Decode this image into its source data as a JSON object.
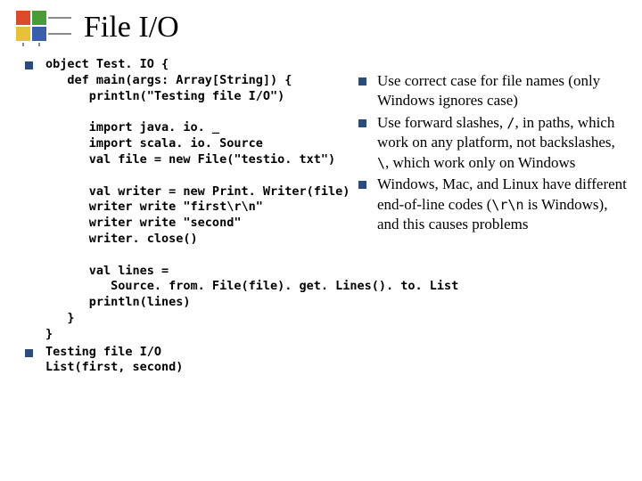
{
  "title": "File I/O",
  "code1": "object Test. IO {\n   def main(args: Array[String]) {\n      println(\"Testing file I/O\")\n\n      import java. io. _\n      import scala. io. Source\n      val file = new File(\"testio. txt\")\n\n      val writer = new Print. Writer(file)\n      writer write \"first\\r\\n\"\n      writer write \"second\"\n      writer. close()\n\n      val lines =\n         Source. from. File(file). get. Lines(). to. List\n      println(lines)\n   }\n}",
  "code2": "Testing file I/O\nList(first, second)",
  "notes": {
    "n1a": "Use correct case for file names (only Windows ignores case)",
    "n2a": "Use forward slashes, ",
    "n2b": "/",
    "n2c": ", in paths, which work on any platform, not backslashes, ",
    "n2d": "\\",
    "n2e": ", which work only on Windows",
    "n3a": "Windows, Mac, and Linux have different end-of-line codes (",
    "n3b": "\\r\\n",
    "n3c": " is Windows), and this causes problems"
  }
}
